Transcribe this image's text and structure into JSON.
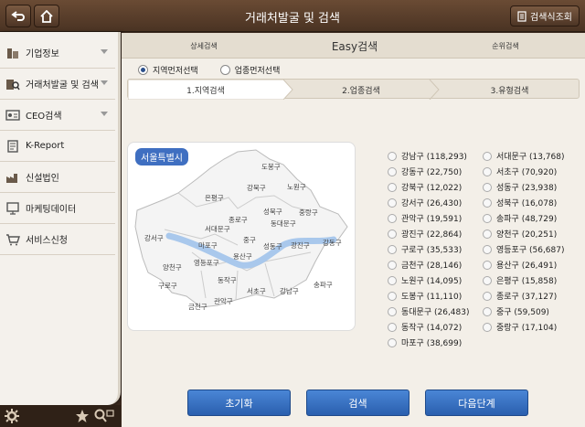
{
  "header": {
    "title": "거래처발굴 및 검색",
    "right_button_label": "검색식조회"
  },
  "sidebar": {
    "items": [
      {
        "label": "기업정보",
        "has_chevron": true
      },
      {
        "label": "거래처발굴 및 검색",
        "has_chevron": true
      },
      {
        "label": "CEO검색",
        "has_chevron": true
      },
      {
        "label": "K-Report",
        "has_chevron": false
      },
      {
        "label": "신설법인",
        "has_chevron": false
      },
      {
        "label": "마케팅데이터",
        "has_chevron": false
      },
      {
        "label": "서비스신청",
        "has_chevron": false
      }
    ]
  },
  "search_tabs": {
    "detail": "상세검색",
    "easy": "Easy검색",
    "rank": "순위검색"
  },
  "radios": {
    "region": "지역먼저선택",
    "industry": "업종먼저선택",
    "selected": "region"
  },
  "steps": [
    "1.지역검색",
    "2.업종검색",
    "3.유형검색"
  ],
  "map": {
    "label": "서울특별시",
    "districts": [
      "도봉구",
      "노원구",
      "강북구",
      "은평구",
      "성북구",
      "중랑구",
      "종로구",
      "동대문구",
      "서대문구",
      "강서구",
      "마포구",
      "중구",
      "성동구",
      "광진구",
      "강동구",
      "용산구",
      "영등포구",
      "양천구",
      "구로구",
      "동작구",
      "서초구",
      "강남구",
      "송파구",
      "금천구",
      "관악구"
    ],
    "river_color": "#a9c8ec"
  },
  "districts_left": [
    "강남구 (118,293)",
    "강동구 (22,750)",
    "강북구 (12,022)",
    "강서구 (26,430)",
    "관악구 (19,591)",
    "광진구 (22,864)",
    "구로구 (35,533)",
    "금천구 (28,146)",
    "노원구 (14,095)",
    "도봉구 (11,110)",
    "동대문구 (26,483)",
    "동작구 (14,072)",
    "마포구 (38,699)"
  ],
  "districts_right": [
    "서대문구 (13,768)",
    "서초구 (70,920)",
    "성동구 (23,938)",
    "성북구 (16,078)",
    "송파구 (48,729)",
    "양천구 (20,251)",
    "영등포구 (56,687)",
    "용산구 (26,491)",
    "은평구 (15,858)",
    "종로구 (37,127)",
    "중구 (59,509)",
    "중랑구 (17,104)"
  ],
  "buttons": {
    "reset": "초기화",
    "search": "검색",
    "next": "다음단계"
  },
  "colors": {
    "topbar": "#5a3f2c",
    "button_blue": "#3a75c8",
    "map_label": "#3f6fc1"
  }
}
